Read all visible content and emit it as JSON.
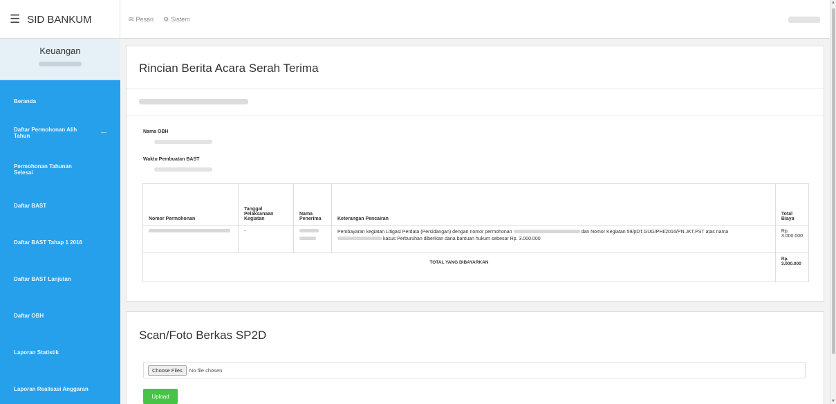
{
  "app": {
    "brand": "SID BANKUM",
    "menu_icon": "hamburger-icon"
  },
  "topnav": [
    {
      "icon": "envelope-icon",
      "glyph": "✉",
      "label": "Pesan"
    },
    {
      "icon": "cogs-icon",
      "glyph": "⚙",
      "label": "Sistem"
    }
  ],
  "sidebar": {
    "role": "Keuangan",
    "items": [
      {
        "label": "Beranda"
      },
      {
        "label": "Daftar Permohonan Alih Tahun",
        "chevron": "—"
      },
      {
        "label": "Permohonan Tahunan Selesai"
      },
      {
        "label": "Daftar BAST"
      },
      {
        "label": "Daftar BAST Tahap 1 2016"
      },
      {
        "label": "Daftar BAST Lanjutan"
      },
      {
        "label": "Daftar OBH"
      },
      {
        "label": "Laporan Statistik"
      },
      {
        "label": "Laporan Realisasi Anggaran"
      }
    ]
  },
  "detail": {
    "title": "Rincian Berita Acara Serah Terima",
    "nama_obh_label": "Nama OBH",
    "waktu_label": "Waktu Pembuatan BAST",
    "table": {
      "headers": [
        "Nomor Permohonan",
        "Tanggal Pelaksanaan Kegiatan",
        "Nama Penerima",
        "Keterangan Pencairan",
        "Total Biaya"
      ],
      "rows": [
        {
          "nomor": "",
          "tanggal": "-",
          "penerima": "",
          "keterangan_part1": "Pembayaran kegiatan Litigasi Perdata (Persidangan) dengan nomor permohonan",
          "keterangan_part2": "dan Nomor Kegiatan",
          "keterangan_part3": "59/pDT.GUG/PHI/2016/PN.JKT.PST atas nama",
          "keterangan_part4": "kasus Perburuhan diberikan dana bantuan hukum sebesar Rp. 3.000.000",
          "total": "Rp. 3.000.000"
        }
      ],
      "total_label": "TOTAL YANG DIBAYARKAN",
      "total_value": "Rp. 3.000.000"
    }
  },
  "upload": {
    "title": "Scan/Foto Berkas SP2D",
    "choose_label": "Choose Files",
    "no_file": "No file chosen",
    "upload_label": "Upload"
  }
}
